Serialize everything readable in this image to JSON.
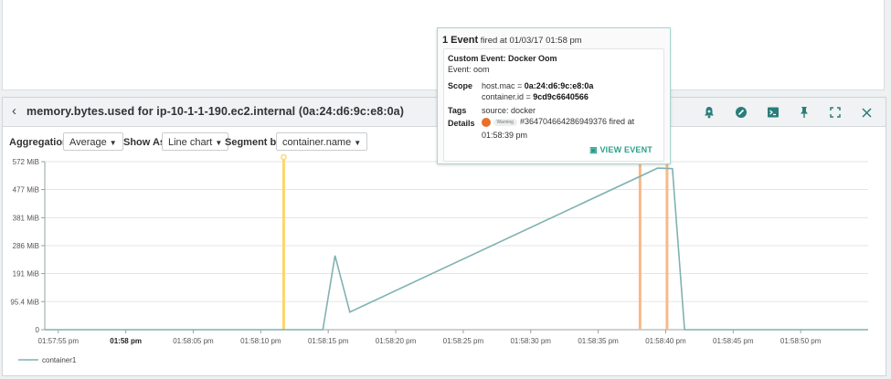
{
  "widget": {
    "title": "memory.bytes.used for ip-10-1-1-190.ec2.internal (0a:24:d6:9c:e8:0a)"
  },
  "controls": {
    "aggregation_label": "Aggregation",
    "aggregation_value": "Average",
    "show_as_label": "Show As",
    "show_as_value": "Line chart",
    "segment_by_label": "Segment by",
    "segment_by_value": "container.name"
  },
  "header_icons": [
    "alert-bell-icon",
    "explore-icon",
    "terminal-icon",
    "pin-icon",
    "fullscreen-icon",
    "close-icon"
  ],
  "colors": {
    "line": "#7fb2b1",
    "event_yellow": "#ffd56b",
    "event_orange": "#f8b98a",
    "accent": "#2aa08a",
    "warning": "#e8702a"
  },
  "popup": {
    "count": "1 Event",
    "fired_text": "fired at 01/03/17 01:58 pm",
    "event_name": "Custom Event: Docker Oom",
    "event_line": "Event: oom",
    "scope_label": "Scope",
    "scope_host_key": "host.mac = ",
    "scope_host_val": "0a:24:d6:9c:e8:0a",
    "scope_container_key": "container.id = ",
    "scope_container_val": "9cd9c6640566",
    "tags_label": "Tags",
    "tags_value": "source: docker",
    "details_label": "Details",
    "details_badge": "Warning",
    "details_text": "#364704664286949376 fired at",
    "details_time": "01:58:39 pm",
    "view_event": "VIEW EVENT"
  },
  "chart_data": {
    "type": "line",
    "yticks": [
      0,
      95.4,
      191,
      286,
      381,
      477,
      572
    ],
    "ytick_labels": [
      "0",
      "95.4 MiB",
      "191 MiB",
      "286 MiB",
      "381 MiB",
      "477 MiB",
      "572 MiB"
    ],
    "ylim": [
      0,
      572
    ],
    "xlim": [
      0,
      61
    ],
    "xticks": [
      1,
      6,
      11,
      16,
      21,
      26,
      31,
      36,
      41,
      46,
      51,
      56
    ],
    "xtick_labels": [
      "01:57:55 pm",
      "01:58 pm",
      "01:58:05 pm",
      "01:58:10 pm",
      "01:58:15 pm",
      "01:58:20 pm",
      "01:58:25 pm",
      "01:58:30 pm",
      "01:58:35 pm",
      "01:58:40 pm",
      "01:58:45 pm",
      "01:58:50 pm"
    ],
    "bold_xtick_index": 1,
    "series": [
      {
        "name": "container1",
        "x": [
          0,
          20.6,
          21.5,
          22.6,
          45.4,
          46.5,
          47.4,
          61
        ],
        "y": [
          0,
          0,
          252,
          60,
          550,
          548,
          0,
          0
        ]
      }
    ],
    "events": [
      {
        "x": 17.7,
        "color": "yellow"
      },
      {
        "x": 44.1,
        "color": "orange"
      },
      {
        "x": 46.1,
        "color": "orange"
      }
    ],
    "grid": true,
    "legend": "bottom-left"
  }
}
